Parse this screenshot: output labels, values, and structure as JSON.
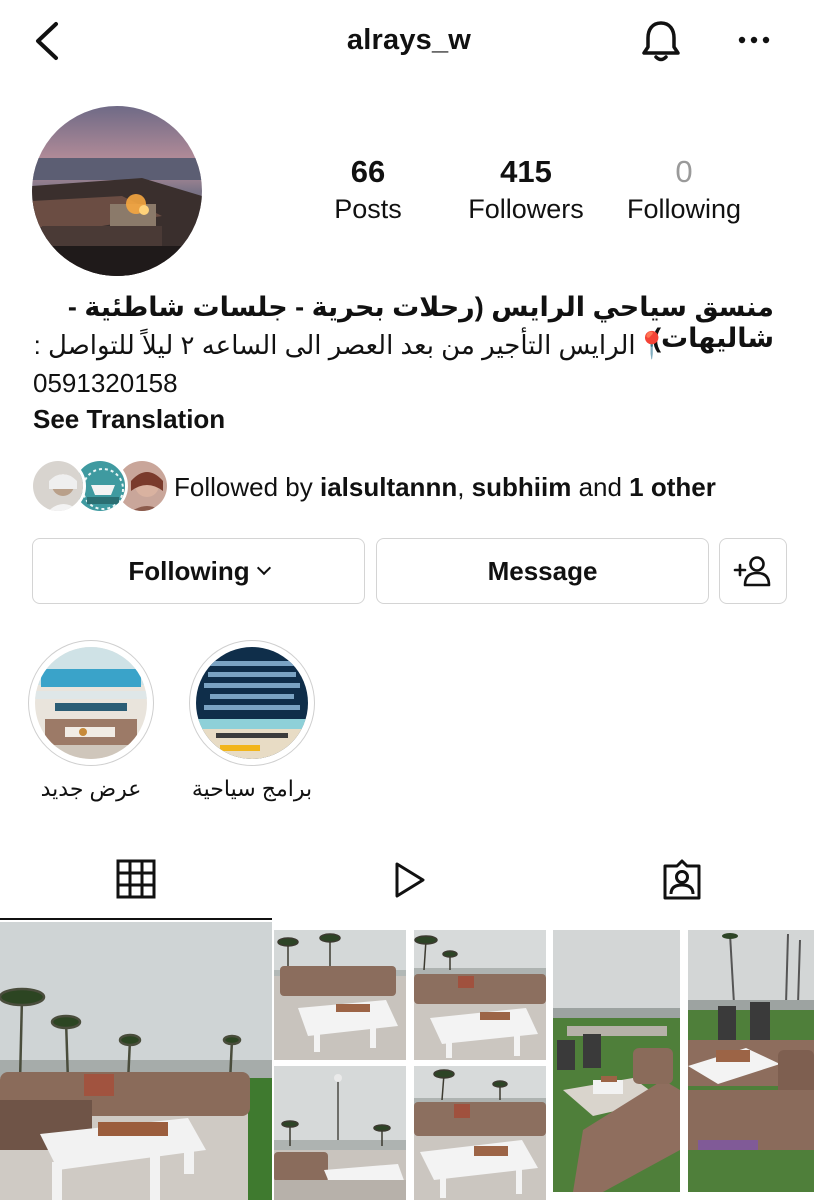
{
  "header": {
    "username": "alrays_w",
    "back_icon": "chevron-left-icon",
    "bell_icon": "bell-icon",
    "more_icon": "more-horizontal-icon"
  },
  "profile": {
    "stats": [
      {
        "value": "66",
        "label": "Posts"
      },
      {
        "value": "415",
        "label": "Followers"
      },
      {
        "value": "0",
        "label": "Following"
      }
    ],
    "bio": {
      "name": "منسق سياحي الرايس (رحلات بحرية - جلسات شاطئية - شاليهات)",
      "line": "الرايس التأجير من بعد العصر الى الساعه ٢ ليلاً للتواصل :",
      "pin_icon": "📍",
      "phone": "0591320158",
      "see_translation": "See Translation"
    },
    "followed_by": {
      "prefix": "Followed by ",
      "user1": "ialsultannn",
      "sep": ", ",
      "user2": "subhiim",
      "mid": " and ",
      "others": "1 other"
    }
  },
  "actions": {
    "following_label": "Following",
    "message_label": "Message",
    "add_user_icon": "add-user-icon"
  },
  "highlights": [
    {
      "label": "عرض جديد"
    },
    {
      "label": "برامج سياحية"
    }
  ],
  "tabs": [
    {
      "name": "grid",
      "icon": "grid-icon",
      "active": true
    },
    {
      "name": "reels",
      "icon": "play-icon",
      "active": false
    },
    {
      "name": "tagged",
      "icon": "tagged-person-icon",
      "active": false
    }
  ],
  "colors": {
    "text": "#111111",
    "muted": "#9a9a9a",
    "border": "#d4d4d4"
  }
}
